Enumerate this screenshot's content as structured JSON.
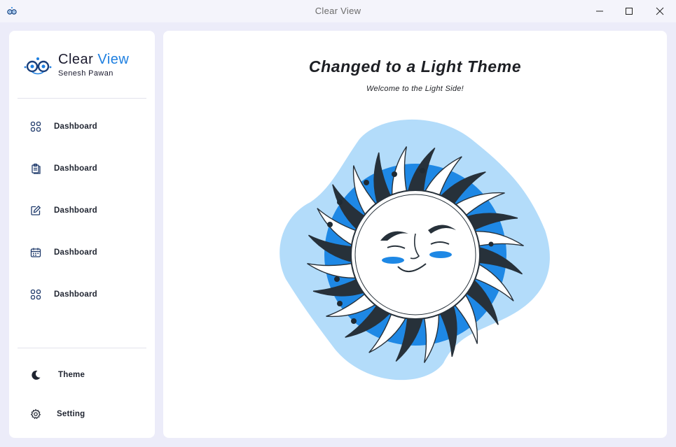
{
  "window": {
    "title": "Clear View",
    "icon": "app-logo-icon",
    "controls": [
      "minimize-icon",
      "maximize-icon",
      "close-icon"
    ]
  },
  "sidebar": {
    "brand": {
      "name_part1": "Clear",
      "name_part2": "View",
      "subtitle": "Senesh Pawan"
    },
    "items": [
      {
        "label": "Dashboard",
        "icon": "grid-icon"
      },
      {
        "label": "Dashboard",
        "icon": "clipboard-icon"
      },
      {
        "label": "Dashboard",
        "icon": "edit-icon"
      },
      {
        "label": "Dashboard",
        "icon": "calendar-icon"
      },
      {
        "label": "Dashboard",
        "icon": "grid-icon"
      }
    ],
    "bottom": [
      {
        "label": "Theme",
        "icon": "moon-icon"
      },
      {
        "label": "Setting",
        "icon": "gear-icon"
      }
    ]
  },
  "main": {
    "title": "Changed to a Light Theme",
    "subtitle": "Welcome to the Light Side!",
    "illustration": "sun-face-illustration"
  },
  "colors": {
    "accent": "#1e7fe0",
    "background": "#ececf9",
    "panel": "#ffffff",
    "illustration_blob": "#b3dcfa",
    "illustration_ring": "#1e88e5",
    "ray_dark": "#27313a"
  }
}
